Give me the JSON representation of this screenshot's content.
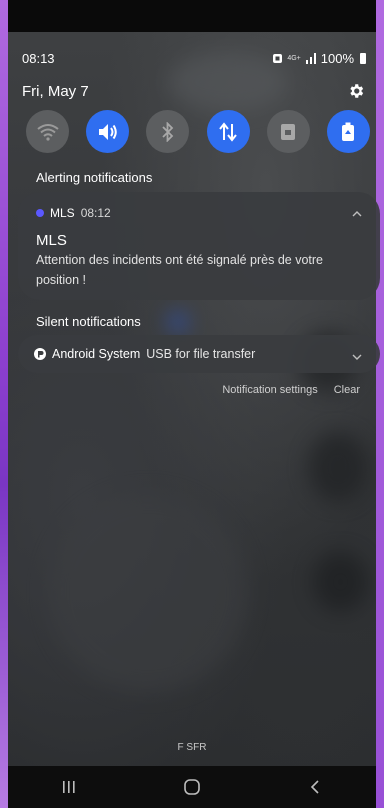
{
  "status_bar": {
    "time": "08:13",
    "network": "4G+",
    "battery": "100%"
  },
  "panel": {
    "date": "Fri, May 7"
  },
  "quick_settings": [
    {
      "name": "wifi",
      "state": "off"
    },
    {
      "name": "sound",
      "state": "on"
    },
    {
      "name": "bluetooth",
      "state": "off"
    },
    {
      "name": "mobile-data",
      "state": "on"
    },
    {
      "name": "screen-lock",
      "state": "off"
    },
    {
      "name": "power-saving",
      "state": "on"
    }
  ],
  "alerting": {
    "section_label": "Alerting notifications",
    "notification": {
      "app": "MLS",
      "time": "08:12",
      "title": "MLS",
      "body": "Attention des incidents ont été signalé près de votre position !"
    }
  },
  "silent": {
    "section_label": "Silent notifications",
    "notification": {
      "app": "Android System",
      "text": "USB for file transfer"
    }
  },
  "actions": {
    "settings": "Notification settings",
    "clear": "Clear"
  },
  "carrier": "F SFR",
  "colors": {
    "accent": "#2f6ef0",
    "frame": "#9b4fd6"
  }
}
